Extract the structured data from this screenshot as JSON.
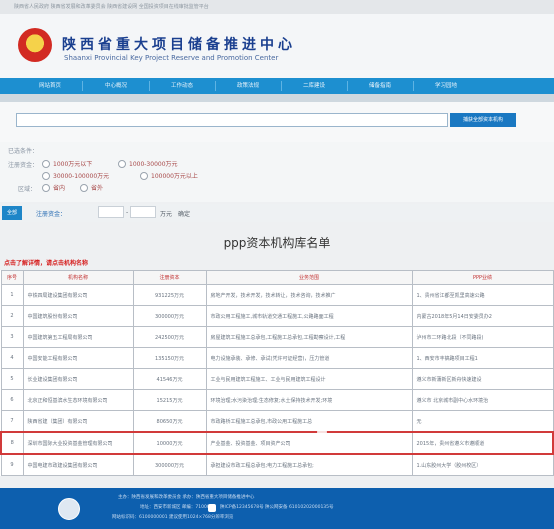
{
  "topbar": {
    "text": "陕西省人民政府    陕西省发展和改革委员会    陕西省建设网    全国投资项目在线审批监管平台"
  },
  "header": {
    "title": "陕西省重大项目储备推进中心",
    "subtitle": "Shaanxi Provincial Key Project Reserve and Promotion Center"
  },
  "nav": {
    "items": [
      "网站首页",
      "中心概况",
      "工作动态",
      "政策法规",
      "二库建设",
      "储备指南",
      "学习园地"
    ]
  },
  "search": {
    "value": "",
    "button_label": "捕获全部资本机构"
  },
  "filters": {
    "selected_label": "已选条件：",
    "capital_label": "注册资金：",
    "capital_options": [
      "1000万元以下",
      "1000-30000万元",
      "30000-100000万元",
      "100000万元以上"
    ],
    "region_label": "区域：",
    "region_options": [
      "省内",
      "省外"
    ]
  },
  "filter_bar": {
    "all_tag": "全部",
    "capital_label": "注册资金：",
    "unit": "万元",
    "go": "确定"
  },
  "library": {
    "title": "ppp资本机构库名单",
    "hint": "点击了解详情，请点击机构名称"
  },
  "table": {
    "headers": [
      "序号",
      "机构名称",
      "注册资本",
      "业务范围",
      "PPP业绩"
    ],
    "rows": [
      {
        "no": "1",
        "name": "中铁四局建设集团有限公司",
        "capital": "931225万元",
        "scope": "房地产开发，技术开发，技术转让，技术咨询，技术推广",
        "ppp": "1、贵州省江都至凯里高速公路"
      },
      {
        "no": "2",
        "name": "中国建筑股份有限公司",
        "capital": "300000万元",
        "scope": "市政公用工程施工,城市轨道交通工程施工,公路路面工程",
        "ppp": "内蒙古2018年5月14日安委员办2"
      },
      {
        "no": "3",
        "name": "中国建筑第五工程局有限公司",
        "capital": "242500万元",
        "scope": "房屋建筑工程施工总承包,工程施工总承包,工程勘察设计,工程",
        "ppp": "泸州市二环路北段（不同路段)"
      },
      {
        "no": "4",
        "name": "中国安能工程有限公司",
        "capital": "135150万元",
        "scope": "电力设施承装、承修、承试(凭许可证经营)，压力管道",
        "ppp": "1、西安市丰镐路项目工程1"
      },
      {
        "no": "5",
        "name": "长业建设集团有限公司",
        "capital": "41546万元",
        "scope": "工业与民用建筑工程施工、工业与民用建筑工程设计",
        "ppp": "遵义市新蒲新区新舟快速建设"
      },
      {
        "no": "6",
        "name": "北京正和恒基滨水生态环境有限公司",
        "capital": "15215万元",
        "scope": "环境治理;水污染治理;生态修复;水土保持技术开发;环境",
        "ppp": "遵义市 北京城市副中心水环境治"
      },
      {
        "no": "7",
        "name": "陕西省建（集团）有限公司",
        "capital": "80650万元",
        "scope": "市政路桥工程施工总承包,市政公用工程施工总",
        "ppp": "无"
      },
      {
        "no": "8",
        "name": "深圳市国际大业投资基金管理有限公司",
        "capital": "10000万元",
        "scope": "产业基金、投资基金、项目资产公司",
        "ppp": "2015年，贵州省遵义市遵顺道"
      },
      {
        "no": "9",
        "name": "中国电建市政建设集团有限公司",
        "capital": "300000万元",
        "scope": "承担建设市政工程总承包;电力工程施工总承包;",
        "ppp": "1.山东胶州大学（胶州校区）"
      }
    ]
  },
  "footer": {
    "line1": "主办：陕西省发展和改革委员会    承办：陕西省重大项目储备推进中心",
    "line2": "地址：西安市新城区    邮编：710006",
    "line3": "陕ICP备12345678号    陕公网安备 61010202000135号",
    "line4": "网站标识码：6100000001    建议使用1024×768分辨率浏览"
  }
}
